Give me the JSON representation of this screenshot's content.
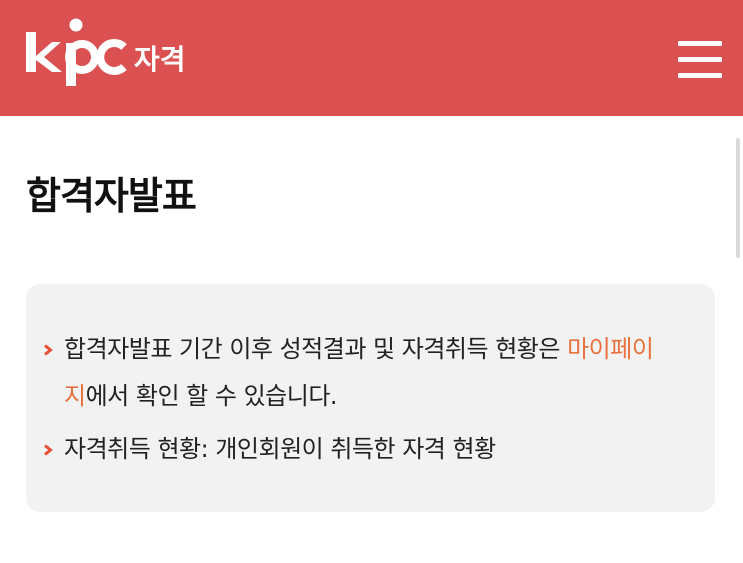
{
  "header": {
    "logo_text": "kpc",
    "logo_sub": "자격",
    "colors": {
      "background": "#db5051",
      "foreground": "#ffffff"
    },
    "menu_icon": "hamburger-menu-icon"
  },
  "page": {
    "title": "합격자발표"
  },
  "notice": {
    "bullet_icon": "chevron-right-icon",
    "items": [
      {
        "before": "합격자발표 기간 이후 성적결과 및 자격취득 현황은 ",
        "link": "마이페이지",
        "after": "에서 확인 할 수 있습니다."
      },
      {
        "text": "자격취득 현황: 개인회원이 취득한 자격 현황"
      }
    ],
    "colors": {
      "box": "#f2f2f2",
      "bullet": "#e8503a",
      "link": "#e8723f"
    }
  }
}
